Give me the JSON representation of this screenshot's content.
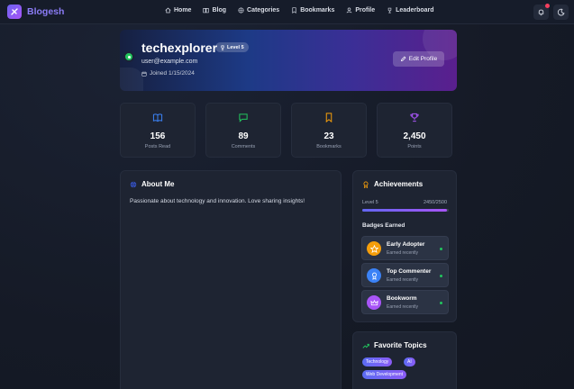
{
  "app": {
    "name": "Blogesh"
  },
  "nav": {
    "items": [
      {
        "label": "Home",
        "icon": "home-icon"
      },
      {
        "label": "Blog",
        "icon": "book-icon"
      },
      {
        "label": "Categories",
        "icon": "globe-icon"
      },
      {
        "label": "Bookmarks",
        "icon": "bookmark-icon"
      },
      {
        "label": "Profile",
        "icon": "user-icon"
      },
      {
        "label": "Leaderboard",
        "icon": "trophy-icon"
      }
    ],
    "actions": [
      "bell-icon",
      "moon-icon"
    ]
  },
  "profile": {
    "username": "techexplorer",
    "level_badge": "Level 5",
    "email": "user@example.com",
    "joined": "Joined 1/15/2024",
    "edit_label": "Edit Profile"
  },
  "stats": [
    {
      "value": "156",
      "label": "Posts Read",
      "icon": "book-open-icon",
      "color": "#3b82f6"
    },
    {
      "value": "89",
      "label": "Comments",
      "icon": "comment-icon",
      "color": "#22c55e"
    },
    {
      "value": "23",
      "label": "Bookmarks",
      "icon": "bookmark-icon",
      "color": "#f59e0b"
    },
    {
      "value": "2,450",
      "label": "Points",
      "icon": "trophy-icon",
      "color": "#a855f7"
    }
  ],
  "about": {
    "title": "About Me",
    "text": "Passionate about technology and innovation. Love sharing insights!"
  },
  "achievements": {
    "title": "Achievements",
    "level": "Level 5",
    "progress_text": "2450/2500",
    "progress": 0.98,
    "badges_label": "Badges Earned",
    "badges": [
      {
        "name": "Early Adopter",
        "sub": "Earned recently",
        "icon": "star-icon",
        "color": "#f59e0b"
      },
      {
        "name": "Top Commenter",
        "sub": "Earned recently",
        "icon": "medal-icon",
        "color": "#3b82f6"
      },
      {
        "name": "Bookworm",
        "sub": "Earned recently",
        "icon": "crown-icon",
        "color": "#a855f7"
      }
    ]
  },
  "topics": {
    "title": "Favorite Topics",
    "tags": [
      "Technology",
      "AI",
      "Web Development"
    ]
  },
  "colors": {
    "accent": "#8b7cf6",
    "online": "#22c55e",
    "notification": "#f43f5e"
  }
}
